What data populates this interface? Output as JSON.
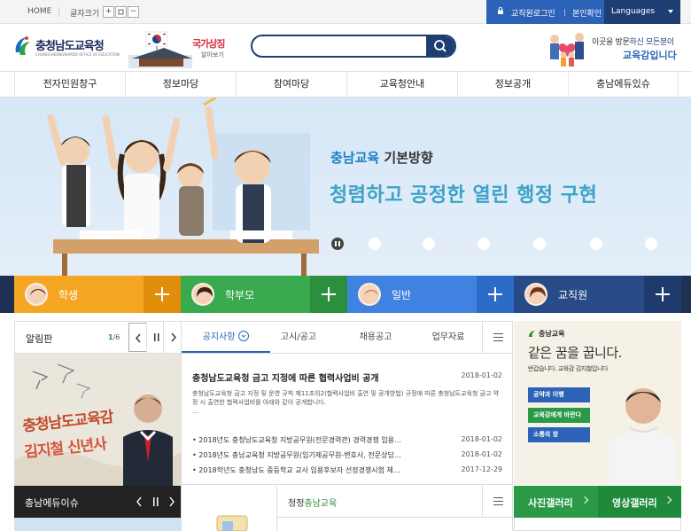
{
  "util": {
    "home": "HOME",
    "font_size_label": "글자크기",
    "font_plus": "+",
    "font_reset": "ㅁ",
    "font_minus": "−",
    "staff_login": "교직원로그인",
    "identity_check": "본인확인",
    "languages": "Languages"
  },
  "header": {
    "logo_name": "충청남도교육청",
    "logo_en": "CHUNGCHEONGNAMDO OFFICE OF EDUCATION",
    "nation_title": "국가상징",
    "nation_sub": "알아보기",
    "search_placeholder": "",
    "visit_text_1": "이곳을 방문",
    "visit_text_2": "하신 모든분이",
    "visit_text_3": "교육감입니다"
  },
  "gnb": [
    "전자민원창구",
    "정보마당",
    "참여마당",
    "교육청안내",
    "정보공개",
    "충남에듀있슈"
  ],
  "visual": {
    "subtitle_brand": "충남교육",
    "subtitle_rest": " 기본방향",
    "headline": "청렴하고 공정한 열린 행정 구현"
  },
  "audience": [
    {
      "label": "학생",
      "color": "#f5a623",
      "plus_color": "#e08e0b"
    },
    {
      "label": "학부모",
      "color": "#3aaa4f",
      "plus_color": "#2b8f3e"
    },
    {
      "label": "일반",
      "color": "#3f82e0",
      "plus_color": "#2c6bc8"
    },
    {
      "label": "교직원",
      "color": "#284a86",
      "plus_color": "#1f3a6c"
    }
  ],
  "notice_panel": {
    "title": "알림판",
    "page_current": "1",
    "page_total": "/6",
    "image_text_1": "충청남도교육감",
    "image_text_2": "김지철 신년사"
  },
  "board": {
    "tabs": [
      "공지사항",
      "고시/공고",
      "채용공고",
      "업무자료"
    ],
    "feature_title": "충청남도교육청 금고 지정에 따른 협력사업비 공개",
    "feature_date": "2018-01-02",
    "feature_desc": "충청남도교육청 금고 지정 및 운영 규칙 제11조의2(협력사업비 출연 및 공개방법) 규정에 따른 충청남도교육청 금고 약정 시 출연한 협력사업비를 아래와 같이 공개합니다.",
    "feature_more": "...",
    "items": [
      {
        "title": "• 2018년도 충청남도교육청 지방공무원(전문경력관) 경력경쟁 임용…",
        "date": "2018-01-02"
      },
      {
        "title": "• 2018년도 충남교육청 지방공무원(임기제공무원-변호사, 전문상담…",
        "date": "2018-01-02"
      },
      {
        "title": "• 2018학년도 충청남도 중등학교 교사 임용후보자 선정경쟁시험 제…",
        "date": "2017-12-29"
      }
    ]
  },
  "promo": {
    "brand": "충남교육",
    "headline": "같은 꿈을 꿉니다.",
    "sub": "반갑습니다. 교육감 김지철입니다",
    "buttons": [
      "공약과 이행",
      "교육감에게 바란다",
      "소통의 창"
    ]
  },
  "bottom": {
    "edu_issue": "충남에듀이슈",
    "clean_prefix": "청정",
    "clean_brand": "충남교육",
    "photo_gallery": "사진갤러리",
    "video_gallery": "영상갤러리"
  }
}
